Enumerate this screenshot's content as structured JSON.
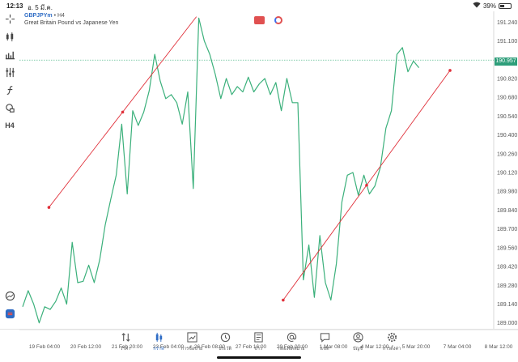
{
  "status_bar": {
    "time": "12:13",
    "date": "อ. 5 มี.ค.",
    "battery": "39%",
    "battery_level": 0.39
  },
  "symbol": {
    "name": "GBPJPYm",
    "separator": "•",
    "timeframe": "H4",
    "description": "Great Britain Pound vs Japanese Yen"
  },
  "left_toolbar": [
    {
      "name": "crosshair-icon"
    },
    {
      "name": "candlestick-type-icon"
    },
    {
      "name": "bar-chart-type-icon"
    },
    {
      "name": "indicators-sliders-icon"
    },
    {
      "name": "function-icon"
    },
    {
      "name": "shapes-icon"
    },
    {
      "name": "timeframe-h4",
      "label": "H4"
    },
    {
      "name": "history-clock-icon"
    },
    {
      "name": "one-click-trade-icon"
    }
  ],
  "current_price": "190.957",
  "colors": {
    "line": "#3bb07b",
    "trendline": "#e0303a",
    "price_tag": "#2e9e7a",
    "accent": "#2e6cc5"
  },
  "chart_data": {
    "type": "line",
    "y_ticks": [
      "191.240",
      "191.100",
      "190.957",
      "190.820",
      "190.680",
      "190.540",
      "190.400",
      "190.260",
      "190.120",
      "189.980",
      "189.840",
      "189.700",
      "189.560",
      "189.420",
      "189.280",
      "189.140",
      "189.000"
    ],
    "x_ticks": [
      "19 Feb 04:00",
      "20 Feb 12:00",
      "21 Feb 20:00",
      "23 Feb 04:00",
      "26 Feb 08:00",
      "27 Feb 16:00",
      "29 Feb 00:00",
      "1 Mar 08:00",
      "4 Mar 12:00",
      "5 Mar 20:00",
      "7 Mar 04:00",
      "8 Mar 12:00"
    ],
    "ylim": [
      188.95,
      191.32
    ],
    "x": [
      0,
      0.1,
      0.2,
      0.3,
      0.4,
      0.5,
      0.6,
      0.7,
      0.8,
      0.9,
      1,
      1.1,
      1.2,
      1.3,
      1.4,
      1.5,
      1.6,
      1.7,
      1.8,
      1.9,
      2,
      2.1,
      2.2,
      2.3,
      2.4,
      2.5,
      2.6,
      2.7,
      2.8,
      2.9,
      3,
      3.1,
      3.2,
      3.3,
      3.4,
      3.5,
      3.6,
      3.7,
      3.8,
      3.9,
      4,
      4.1,
      4.2,
      4.3,
      4.4,
      4.5,
      4.6,
      4.7,
      4.8,
      4.9,
      5,
      5.1,
      5.2,
      5.3,
      5.4,
      5.5,
      5.6,
      5.7,
      5.8,
      5.9,
      6,
      6.1,
      6.2,
      6.3,
      6.4,
      6.5,
      6.6,
      6.7,
      6.8,
      6.9,
      7,
      7.1,
      7.2,
      7.3,
      7.4,
      7.5,
      7.6,
      7.7,
      7.8,
      7.9,
      8,
      8.1,
      8.2,
      8.3,
      8.4
    ],
    "values": [
      189.12,
      189.24,
      189.14,
      189.0,
      189.12,
      189.1,
      189.16,
      189.26,
      189.14,
      189.6,
      189.3,
      189.31,
      189.43,
      189.3,
      189.47,
      189.73,
      189.92,
      190.1,
      190.48,
      189.96,
      190.58,
      190.47,
      190.57,
      190.73,
      191.0,
      190.8,
      190.67,
      190.7,
      190.64,
      190.48,
      190.72,
      190.0,
      191.27,
      191.1,
      191.0,
      190.85,
      190.67,
      190.82,
      190.7,
      190.76,
      190.72,
      190.83,
      190.72,
      190.78,
      190.82,
      190.7,
      190.79,
      190.58,
      190.82,
      190.64,
      190.64,
      189.32,
      189.58,
      189.19,
      189.65,
      189.3,
      189.17,
      189.44,
      189.9,
      190.1,
      190.12,
      189.95,
      190.1,
      189.96,
      190.02,
      190.16,
      190.45,
      190.58,
      191.0,
      191.05,
      190.87,
      190.95,
      190.9
    ]
  },
  "trendlines": [
    {
      "from": [
        1.22,
        189.86
      ],
      "to": [
        8.07,
        191.28
      ]
    },
    {
      "from": [
        12.1,
        189.17
      ],
      "to": [
        19.85,
        190.88
      ]
    }
  ],
  "bottom_tabs": [
    {
      "icon": "quotes-arrows-icon",
      "label": "ราคา",
      "active": false
    },
    {
      "icon": "chart-candles-icon",
      "label": "กราฟ",
      "active": true
    },
    {
      "icon": "trade-chart-icon",
      "label": "การซื้อขาย",
      "active": false
    },
    {
      "icon": "history-clock-icon",
      "label": "ประวัติ",
      "active": false
    },
    {
      "icon": "news-icon",
      "label": "ข่าว",
      "active": false
    },
    {
      "icon": "mailbox-at-icon",
      "label": "กล่องจดหมาย",
      "active": false
    },
    {
      "icon": "chat-bubble-icon",
      "label": "แชท",
      "active": false
    },
    {
      "icon": "account-user-icon",
      "label": "บัญชี",
      "active": false
    },
    {
      "icon": "settings-gear-icon",
      "label": "การตั้งค่า",
      "active": false
    }
  ]
}
